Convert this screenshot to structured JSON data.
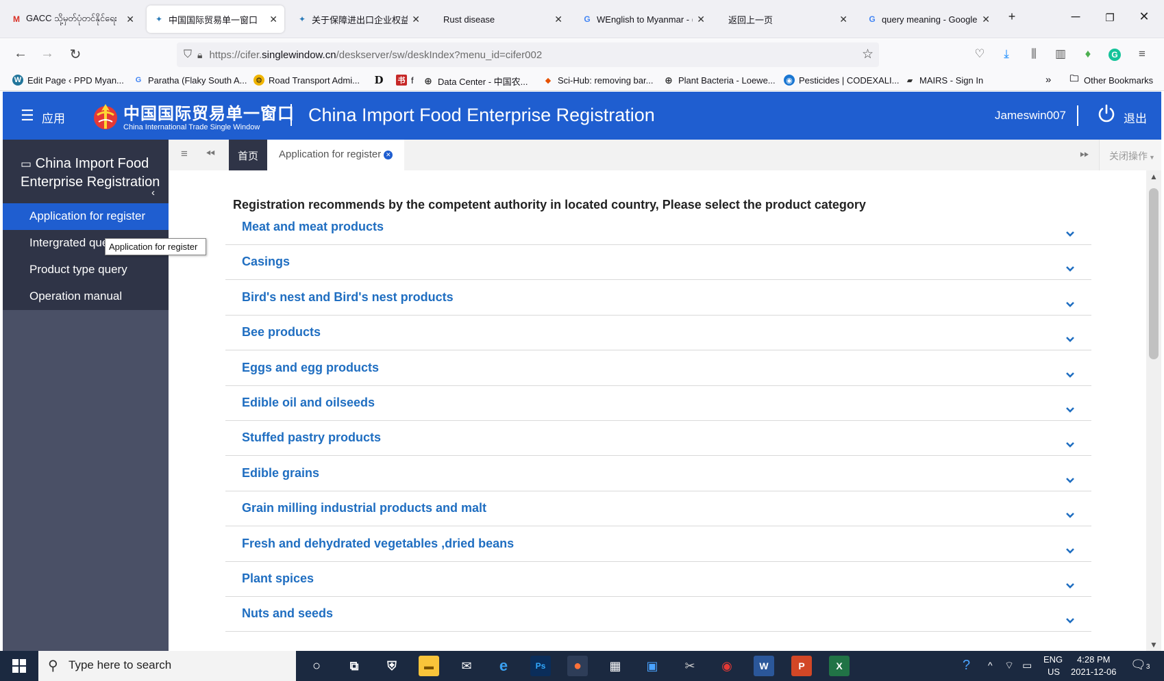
{
  "browser": {
    "tabs": [
      {
        "title": "GACC သို့မှတ်ပုံတင်နိုင်ရေး",
        "favicon": "gmail-icon"
      },
      {
        "title": "中国国际贸易单一窗口",
        "favicon": "singlewindow-icon"
      },
      {
        "title": "关于保障进出口企业权益",
        "favicon": "singlewindow-icon"
      },
      {
        "title": "Rust disease",
        "favicon": ""
      },
      {
        "title": "WEnglish to Myanmar - (",
        "favicon": "google-icon"
      },
      {
        "title": "返回上一页",
        "favicon": ""
      },
      {
        "title": "query meaning - Google",
        "favicon": "google-icon"
      }
    ],
    "url_prefix": "https://cifer.",
    "url_host": "singlewindow.cn",
    "url_path": "/deskserver/sw/deskIndex?menu_id=cifer002",
    "bookmarks": [
      "Edit Page ‹ PPD Myan...",
      "Paratha (Flaky South A...",
      "Road Transport Admi...",
      "",
      "f",
      "Data Center - 中国农...",
      "Sci-Hub: removing bar...",
      "Plant Bacteria - Loewe...",
      "Pesticides | CODEXALI...",
      "MAIRS - Sign In"
    ],
    "other_bookmarks": "Other Bookmarks"
  },
  "header": {
    "apps_label": "应用",
    "logo_cn": "中国国际贸易单一窗口",
    "logo_en": "China International Trade Single Window",
    "title": "China Import Food Enterprise Registration",
    "username": "Jameswin007",
    "logout": "退出"
  },
  "sidebar": {
    "title": "China Import Food Enterprise Registration",
    "items": [
      {
        "label": "Application for register",
        "active": true
      },
      {
        "label": "Intergrated query",
        "active": false
      },
      {
        "label": "Product type query",
        "active": false
      },
      {
        "label": "Operation manual",
        "active": false
      }
    ],
    "tooltip": "Application for register"
  },
  "page_tabs": {
    "home": "首页",
    "current": "Application for register",
    "close_ops": "关闭操作"
  },
  "content": {
    "heading": "Registration recommends by the competent authority in located country, Please select the product category",
    "categories": [
      "Meat and meat products",
      "Casings",
      "Bird's nest and Bird's nest products",
      "Bee products",
      "Eggs and egg products",
      "Edible oil and oilseeds",
      "Stuffed pastry products",
      "Edible grains",
      "Grain milling industrial products and malt",
      "Fresh and dehydrated vegetables ,dried beans",
      "Plant spices",
      "Nuts and seeds"
    ]
  },
  "taskbar": {
    "search_placeholder": "Type here to search",
    "lang": "ENG",
    "region": "US",
    "time": "4:28 PM",
    "date": "2021-12-06",
    "notifications": "3"
  },
  "colors": {
    "brand_blue": "#1f5ed0",
    "link_blue": "#1f6ec1",
    "sidebar_dark": "#2f3447",
    "sidebar_body": "#4a5066"
  }
}
